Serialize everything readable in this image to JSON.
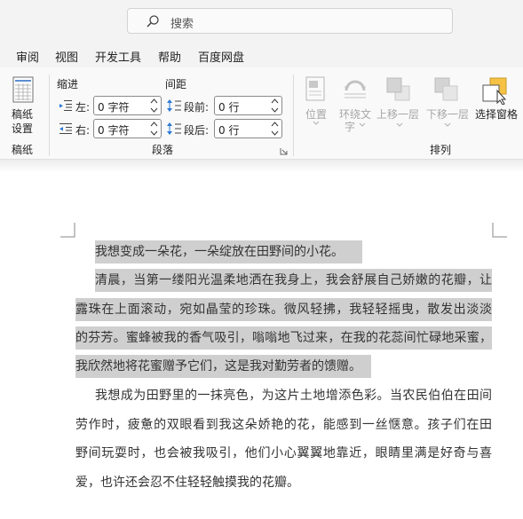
{
  "search": {
    "placeholder": "搜索"
  },
  "menu": [
    "审阅",
    "视图",
    "开发工具",
    "帮助",
    "百度网盘"
  ],
  "paper_group": {
    "button_label_1": "稿纸",
    "button_label_2": "设置",
    "group_label": "稿纸"
  },
  "paragraph_group": {
    "indent_heading": "缩进",
    "spacing_heading": "间距",
    "left_label": "左:",
    "right_label": "右:",
    "before_label": "段前:",
    "after_label": "段后:",
    "left_value": "0 字符",
    "right_value": "0 字符",
    "before_value": "0 行",
    "after_value": "0 行",
    "group_label": "段落"
  },
  "arrange_group": {
    "position_label": "位置",
    "wrap_label_1": "环绕文",
    "wrap_label_2": "字",
    "bring_forward_label": "上移一层",
    "send_backward_label": "下移一层",
    "selection_pane_label": "选择窗格",
    "group_label": "排列"
  },
  "document": {
    "lines": [
      "我想变成一朵花，一朵绽放在田野间的小花。",
      "清晨，当第一缕阳光温柔地洒在我身上，我会舒展自己娇嫩的花瓣，让",
      "露珠在上面滚动，宛如晶莹的珍珠。微风轻拂，我轻轻摇曳，散发出淡淡",
      "的芬芳。蜜蜂被我的香气吸引，嗡嗡地飞过来，在我的花蕊间忙碌地采蜜，",
      "我欣然地将花蜜赠予它们，这是我对勤劳者的馈赠。",
      "我想成为田野里的一抹亮色，为这片土地增添色彩。当农民伯伯在田间",
      "劳作时，疲惫的双眼看到我这朵娇艳的花，能感到一丝惬意。孩子们在田",
      "野间玩耍时，也会被我吸引，他们小心翼翼地靠近，眼睛里满是好奇与喜",
      "爱，也许还会忍不住轻轻触摸我的花瓣。"
    ]
  },
  "colors": {
    "selection": "#cfcfcf",
    "selection_pane_icon": "#f6c244"
  }
}
